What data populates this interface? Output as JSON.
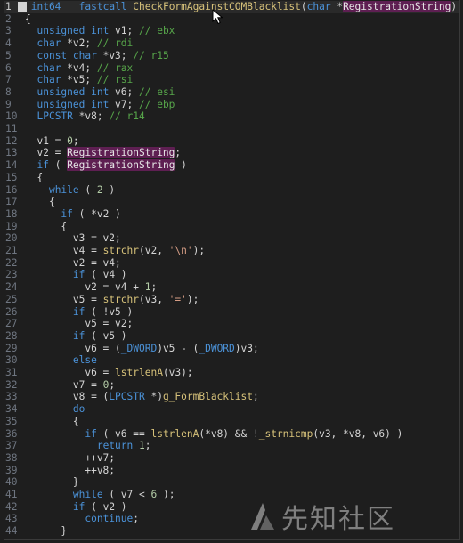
{
  "code_lines": [
    {
      "n": "1",
      "tokens": [
        [
          "",
          "tp",
          "_int64"
        ],
        [
          "",
          "var",
          " "
        ],
        [
          "",
          "kw",
          "__fastcall"
        ],
        [
          "",
          "var",
          " "
        ],
        [
          "",
          "fn",
          "CheckFormAgainstCOMBlacklist"
        ],
        [
          "",
          "var",
          "("
        ],
        [
          "",
          "tp",
          "char"
        ],
        [
          "",
          "var",
          " *"
        ],
        [
          "hl",
          "var",
          "RegistrationString"
        ],
        [
          "",
          "var",
          ")"
        ]
      ]
    },
    {
      "n": "2",
      "tokens": [
        [
          "",
          "var",
          "{"
        ]
      ]
    },
    {
      "n": "3",
      "tokens": [
        [
          "",
          "var",
          "  "
        ],
        [
          "",
          "tp",
          "unsigned int"
        ],
        [
          "",
          "var",
          " v1; "
        ],
        [
          "",
          "cm",
          "// ebx"
        ]
      ]
    },
    {
      "n": "4",
      "tokens": [
        [
          "",
          "var",
          "  "
        ],
        [
          "",
          "tp",
          "char"
        ],
        [
          "",
          "var",
          " *v2; "
        ],
        [
          "",
          "cm",
          "// rdi"
        ]
      ]
    },
    {
      "n": "5",
      "tokens": [
        [
          "",
          "var",
          "  "
        ],
        [
          "",
          "tp",
          "const char"
        ],
        [
          "",
          "var",
          " *v3; "
        ],
        [
          "",
          "cm",
          "// r15"
        ]
      ]
    },
    {
      "n": "6",
      "tokens": [
        [
          "",
          "var",
          "  "
        ],
        [
          "",
          "tp",
          "char"
        ],
        [
          "",
          "var",
          " *v4; "
        ],
        [
          "",
          "cm",
          "// rax"
        ]
      ]
    },
    {
      "n": "7",
      "tokens": [
        [
          "",
          "var",
          "  "
        ],
        [
          "",
          "tp",
          "char"
        ],
        [
          "",
          "var",
          " *v5; "
        ],
        [
          "",
          "cm",
          "// rsi"
        ]
      ]
    },
    {
      "n": "8",
      "tokens": [
        [
          "",
          "var",
          "  "
        ],
        [
          "",
          "tp",
          "unsigned int"
        ],
        [
          "",
          "var",
          " v6; "
        ],
        [
          "",
          "cm",
          "// esi"
        ]
      ]
    },
    {
      "n": "9",
      "tokens": [
        [
          "",
          "var",
          "  "
        ],
        [
          "",
          "tp",
          "unsigned int"
        ],
        [
          "",
          "var",
          " v7; "
        ],
        [
          "",
          "cm",
          "// ebp"
        ]
      ]
    },
    {
      "n": "10",
      "tokens": [
        [
          "",
          "var",
          "  "
        ],
        [
          "",
          "tp",
          "LPCSTR"
        ],
        [
          "",
          "var",
          " *v8; "
        ],
        [
          "",
          "cm",
          "// r14"
        ]
      ]
    },
    {
      "n": "11",
      "tokens": []
    },
    {
      "n": "12",
      "tokens": [
        [
          "",
          "var",
          "  v1 = "
        ],
        [
          "",
          "nm",
          "0"
        ],
        [
          "",
          "var",
          ";"
        ]
      ]
    },
    {
      "n": "13",
      "tokens": [
        [
          "",
          "var",
          "  v2 = "
        ],
        [
          "hl",
          "var",
          "RegistrationString"
        ],
        [
          "",
          "var",
          ";"
        ]
      ]
    },
    {
      "n": "14",
      "tokens": [
        [
          "",
          "var",
          "  "
        ],
        [
          "",
          "kw",
          "if"
        ],
        [
          "",
          "var",
          " ( "
        ],
        [
          "hl",
          "var",
          "RegistrationString"
        ],
        [
          "",
          "var",
          " )"
        ]
      ]
    },
    {
      "n": "15",
      "tokens": [
        [
          "",
          "var",
          "  {"
        ]
      ]
    },
    {
      "n": "16",
      "tokens": [
        [
          "",
          "var",
          "    "
        ],
        [
          "",
          "kw",
          "while"
        ],
        [
          "",
          "var",
          " ( "
        ],
        [
          "",
          "nm",
          "2"
        ],
        [
          "",
          "var",
          " )"
        ]
      ]
    },
    {
      "n": "17",
      "tokens": [
        [
          "",
          "var",
          "    {"
        ]
      ]
    },
    {
      "n": "18",
      "tokens": [
        [
          "",
          "var",
          "      "
        ],
        [
          "",
          "kw",
          "if"
        ],
        [
          "",
          "var",
          " ( *v2 )"
        ]
      ]
    },
    {
      "n": "19",
      "tokens": [
        [
          "",
          "var",
          "      {"
        ]
      ]
    },
    {
      "n": "20",
      "tokens": [
        [
          "",
          "var",
          "        v3 = v2;"
        ]
      ]
    },
    {
      "n": "21",
      "tokens": [
        [
          "",
          "var",
          "        v4 = "
        ],
        [
          "",
          "fn",
          "strchr"
        ],
        [
          "",
          "var",
          "(v2, "
        ],
        [
          "",
          "st",
          "'\\n'"
        ],
        [
          "",
          "var",
          ");"
        ]
      ]
    },
    {
      "n": "22",
      "tokens": [
        [
          "",
          "var",
          "        v2 = v4;"
        ]
      ]
    },
    {
      "n": "23",
      "tokens": [
        [
          "",
          "var",
          "        "
        ],
        [
          "",
          "kw",
          "if"
        ],
        [
          "",
          "var",
          " ( v4 )"
        ]
      ]
    },
    {
      "n": "24",
      "tokens": [
        [
          "",
          "var",
          "          v2 = v4 + "
        ],
        [
          "",
          "nm",
          "1"
        ],
        [
          "",
          "var",
          ";"
        ]
      ]
    },
    {
      "n": "25",
      "tokens": [
        [
          "",
          "var",
          "        v5 = "
        ],
        [
          "",
          "fn",
          "strchr"
        ],
        [
          "",
          "var",
          "(v3, "
        ],
        [
          "",
          "st",
          "'='"
        ],
        [
          "",
          "var",
          ");"
        ]
      ]
    },
    {
      "n": "26",
      "tokens": [
        [
          "",
          "var",
          "        "
        ],
        [
          "",
          "kw",
          "if"
        ],
        [
          "",
          "var",
          " ( !v5 )"
        ]
      ]
    },
    {
      "n": "27",
      "tokens": [
        [
          "",
          "var",
          "          v5 = v2;"
        ]
      ]
    },
    {
      "n": "28",
      "tokens": [
        [
          "",
          "var",
          "        "
        ],
        [
          "",
          "kw",
          "if"
        ],
        [
          "",
          "var",
          " ( v5 )"
        ]
      ]
    },
    {
      "n": "29",
      "tokens": [
        [
          "",
          "var",
          "          v6 = ("
        ],
        [
          "",
          "tp",
          "_DWORD"
        ],
        [
          "",
          "var",
          ")v5 - ("
        ],
        [
          "",
          "tp",
          "_DWORD"
        ],
        [
          "",
          "var",
          ")v3;"
        ]
      ]
    },
    {
      "n": "30",
      "tokens": [
        [
          "",
          "var",
          "        "
        ],
        [
          "",
          "kw",
          "else"
        ]
      ]
    },
    {
      "n": "31",
      "tokens": [
        [
          "",
          "var",
          "          v6 = "
        ],
        [
          "",
          "fn",
          "lstrlenA"
        ],
        [
          "",
          "var",
          "(v3);"
        ]
      ]
    },
    {
      "n": "32",
      "tokens": [
        [
          "",
          "var",
          "        v7 = "
        ],
        [
          "",
          "nm",
          "0"
        ],
        [
          "",
          "var",
          ";"
        ]
      ]
    },
    {
      "n": "33",
      "tokens": [
        [
          "",
          "var",
          "        v8 = ("
        ],
        [
          "",
          "tp",
          "LPCSTR"
        ],
        [
          "",
          "var",
          " *)"
        ],
        [
          "",
          "gl",
          "g_FormBlacklist"
        ],
        [
          "",
          "var",
          ";"
        ]
      ]
    },
    {
      "n": "34",
      "tokens": [
        [
          "",
          "var",
          "        "
        ],
        [
          "",
          "kw",
          "do"
        ]
      ]
    },
    {
      "n": "35",
      "tokens": [
        [
          "",
          "var",
          "        {"
        ]
      ]
    },
    {
      "n": "36",
      "tokens": [
        [
          "",
          "var",
          "          "
        ],
        [
          "",
          "kw",
          "if"
        ],
        [
          "",
          "var",
          " ( v6 == "
        ],
        [
          "",
          "fn",
          "lstrlenA"
        ],
        [
          "",
          "var",
          "(*v8) && !"
        ],
        [
          "",
          "fn",
          "_strnicmp"
        ],
        [
          "",
          "var",
          "(v3, *v8, v6) )"
        ]
      ]
    },
    {
      "n": "37",
      "tokens": [
        [
          "",
          "var",
          "            "
        ],
        [
          "",
          "kw",
          "return"
        ],
        [
          "",
          "var",
          " "
        ],
        [
          "",
          "nm",
          "1"
        ],
        [
          "",
          "var",
          ";"
        ]
      ]
    },
    {
      "n": "38",
      "tokens": [
        [
          "",
          "var",
          "          ++v7;"
        ]
      ]
    },
    {
      "n": "39",
      "tokens": [
        [
          "",
          "var",
          "          ++v8;"
        ]
      ]
    },
    {
      "n": "40",
      "tokens": [
        [
          "",
          "var",
          "        }"
        ]
      ]
    },
    {
      "n": "41",
      "tokens": [
        [
          "",
          "var",
          "        "
        ],
        [
          "",
          "kw",
          "while"
        ],
        [
          "",
          "var",
          " ( v7 < "
        ],
        [
          "",
          "nm",
          "6"
        ],
        [
          "",
          "var",
          " );"
        ]
      ]
    },
    {
      "n": "42",
      "tokens": [
        [
          "",
          "var",
          "        "
        ],
        [
          "",
          "kw",
          "if"
        ],
        [
          "",
          "var",
          " ( v2 )"
        ]
      ]
    },
    {
      "n": "43",
      "tokens": [
        [
          "",
          "var",
          "          "
        ],
        [
          "",
          "kw",
          "continue"
        ],
        [
          "",
          "var",
          ";"
        ]
      ]
    },
    {
      "n": "44",
      "tokens": [
        [
          "",
          "var",
          "      }"
        ]
      ]
    }
  ],
  "watermark": {
    "text": "先知社区"
  },
  "colors": {
    "background": "#1e1e1e",
    "keyword": "#4b92d8",
    "function": "#d7c27a",
    "comment": "#57a64a",
    "highlight": "#5e1f52"
  }
}
